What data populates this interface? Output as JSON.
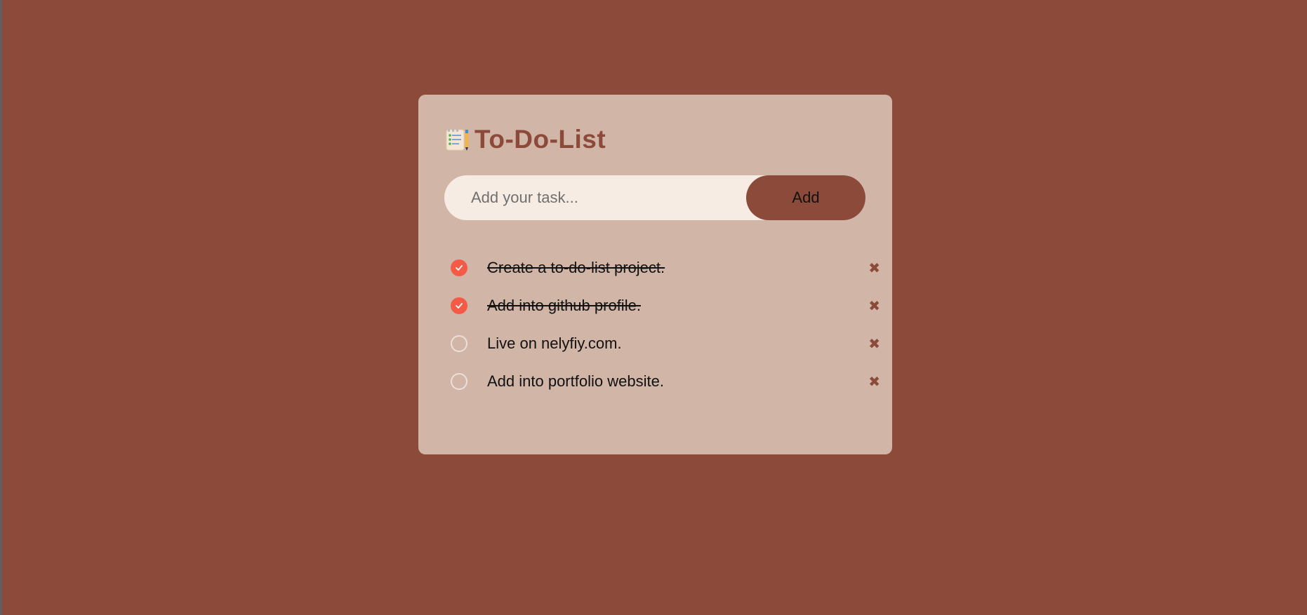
{
  "app": {
    "title": "To-Do-List",
    "title_icon": "notepad-checklist-icon",
    "colors": {
      "background": "#8b4a3a",
      "card": "#d1b6a8",
      "input_bg": "#f7ece4",
      "accent": "#8b4a3a",
      "checked": "#f45a45"
    }
  },
  "input": {
    "placeholder": "Add your task...",
    "value": "",
    "add_label": "Add"
  },
  "tasks": [
    {
      "text": "Create a to-do-list project.",
      "done": true,
      "delete_icon": "close-x-icon"
    },
    {
      "text": "Add into github profile.",
      "done": true,
      "delete_icon": "close-x-icon"
    },
    {
      "text": "Live on nelyfiy.com.",
      "done": false,
      "delete_icon": "close-x-icon"
    },
    {
      "text": "Add into portfolio website.",
      "done": false,
      "delete_icon": "close-x-icon"
    }
  ]
}
